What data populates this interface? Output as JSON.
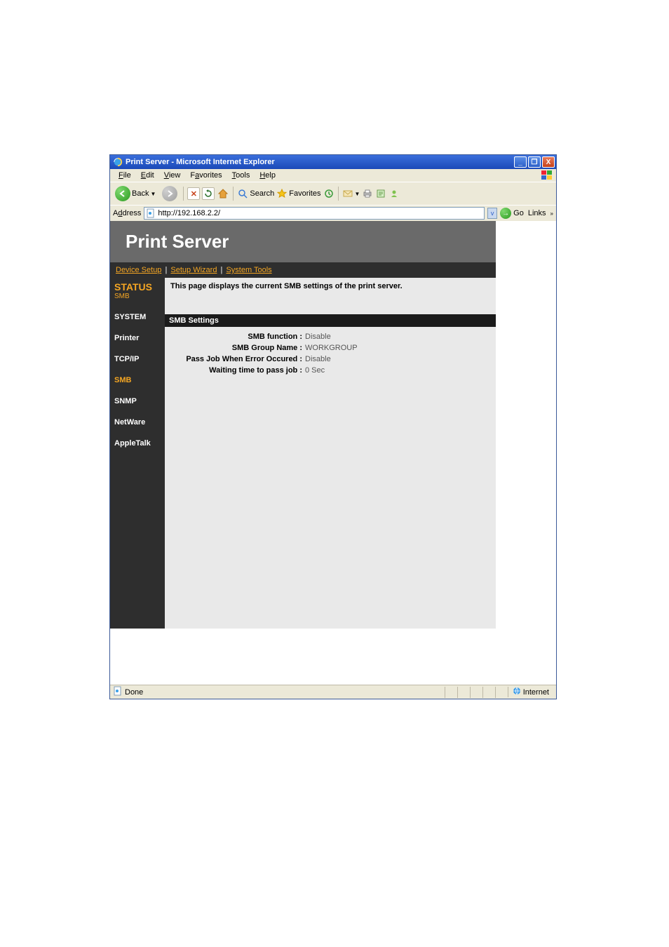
{
  "window": {
    "title": "Print Server - Microsoft Internet Explorer"
  },
  "menu": {
    "file": "File",
    "edit": "Edit",
    "view": "View",
    "favorites": "Favorites",
    "tools": "Tools",
    "help": "Help"
  },
  "toolbar": {
    "back": "Back",
    "search": "Search",
    "favorites": "Favorites"
  },
  "address": {
    "label": "Address",
    "url": "http://192.168.2.2/",
    "go": "Go",
    "links": "Links"
  },
  "page": {
    "header": "Print Server",
    "topnav": {
      "device_setup": "Device Setup",
      "setup_wizard": "Setup Wizard",
      "system_tools": "System Tools"
    },
    "sidebar": {
      "status": "STATUS",
      "status_sub": "SMB",
      "items": [
        "SYSTEM",
        "Printer",
        "TCP/IP",
        "SMB",
        "SNMP",
        "NetWare",
        "AppleTalk"
      ],
      "active_index": 3
    },
    "intro": "This page displays the current SMB settings of the print server.",
    "panel_title": "SMB Settings",
    "settings": [
      {
        "label": "SMB function :",
        "value": "Disable"
      },
      {
        "label": "SMB Group Name :",
        "value": "WORKGROUP"
      },
      {
        "label": "Pass Job When Error Occured :",
        "value": "Disable"
      },
      {
        "label": "Waiting time to pass job :",
        "value": "0 Sec"
      }
    ]
  },
  "status": {
    "done": "Done",
    "zone": "Internet"
  }
}
